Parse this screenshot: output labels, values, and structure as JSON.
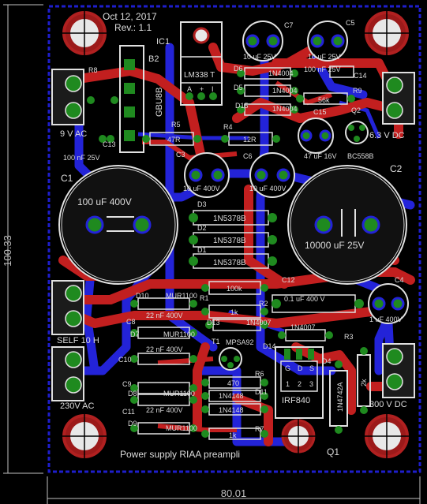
{
  "header": {
    "date": "Oct 12, 2017",
    "revision": "Rev.: 1.1"
  },
  "footer": {
    "title": "Power supply RIAA preampli"
  },
  "dimensions": {
    "height": "100.33",
    "width": "80.01"
  },
  "terminals": {
    "j_9vac": "9 V AC",
    "j_6v3dc": "6.3 V DC",
    "j_self": "SELF 10 H",
    "j_230vac": "230V AC",
    "j_300vdc": "300 V DC"
  },
  "parts": {
    "IC1": "IC1",
    "B2": "B2",
    "R8": "R8",
    "bridge": "GBU8B",
    "regulator": "LM338 T",
    "reg_a": "A",
    "reg_plus": "+",
    "reg_i": "I",
    "C13": "C13",
    "C13_val": "100 nF 25V",
    "C7": "C7",
    "C7_val": "10 uF 25V",
    "C5": "C5",
    "C5_val": "10 uF 25V",
    "C14": "C14",
    "C14_val": "100 nF 25V",
    "D6": "D6",
    "D6_val": "1N4004",
    "D5": "D5",
    "D5_val": "1N4004",
    "D15": "D15",
    "D15_val": "1N4004",
    "R9": "R9",
    "R9_val": "56k",
    "C15": "C15",
    "C15_val": "47 uF 16V",
    "Q2": "Q2",
    "Q2_val": "BC558B",
    "R5": "R5",
    "R5_val": "47R",
    "R4": "R4",
    "R4_val": "12R",
    "C3": "C3",
    "C3_val": "10 uF 400V",
    "C6": "C6",
    "C6_val": "10 uF 400V",
    "C1": "C1",
    "C1_val": "100 uF 400V",
    "C2": "C2",
    "C2_val": "10000 uF 25V",
    "D3": "D3",
    "D3_val": "1N5378B",
    "D2": "D2",
    "D2_val": "1N5378B",
    "D1": "D1",
    "D1_val": "1N5378B",
    "C12": "C12",
    "C12_val": "0.1 uF 400 V",
    "C4": "C4",
    "C4_val": "1 uF 400V",
    "R1": "R1",
    "R1_val": "100k",
    "R2": "R2",
    "R2_val": "1k",
    "D10": "D10",
    "D10_val": "MUR1100",
    "C8": "C8",
    "C8_val": "22 nF 400V",
    "D7": "D7",
    "D7_val": "MUR1100",
    "C10": "C10",
    "C10_val": "22 nF 400V",
    "C9": "C9",
    "D8": "D8",
    "D8_val": "MUR1100",
    "C11": "C11",
    "C11_val": "22 nF 400V",
    "D9": "D9",
    "D9_val": "MUR1100",
    "D13": "D13",
    "D13_val": "1N4007",
    "T1": "T1",
    "T1_val": "MPSA92",
    "D14": "D14",
    "D12_val": "1N4007",
    "R3": "R3",
    "D4": "D4",
    "D4_val": "1N4742A",
    "R6": "R6",
    "R6_val": "470",
    "D11": "D11",
    "D11a_val": "1N4148",
    "D11b_val": "1N4148",
    "R7": "R7",
    "R7_val": "1k",
    "Q1": "Q1",
    "Q1_val": "IRF840",
    "R3_val": "2k",
    "q1_g": "G",
    "q1_d": "D",
    "q1_s": "S",
    "q1_pin1": "1",
    "q1_pin2": "2",
    "q1_pin3": "3"
  }
}
